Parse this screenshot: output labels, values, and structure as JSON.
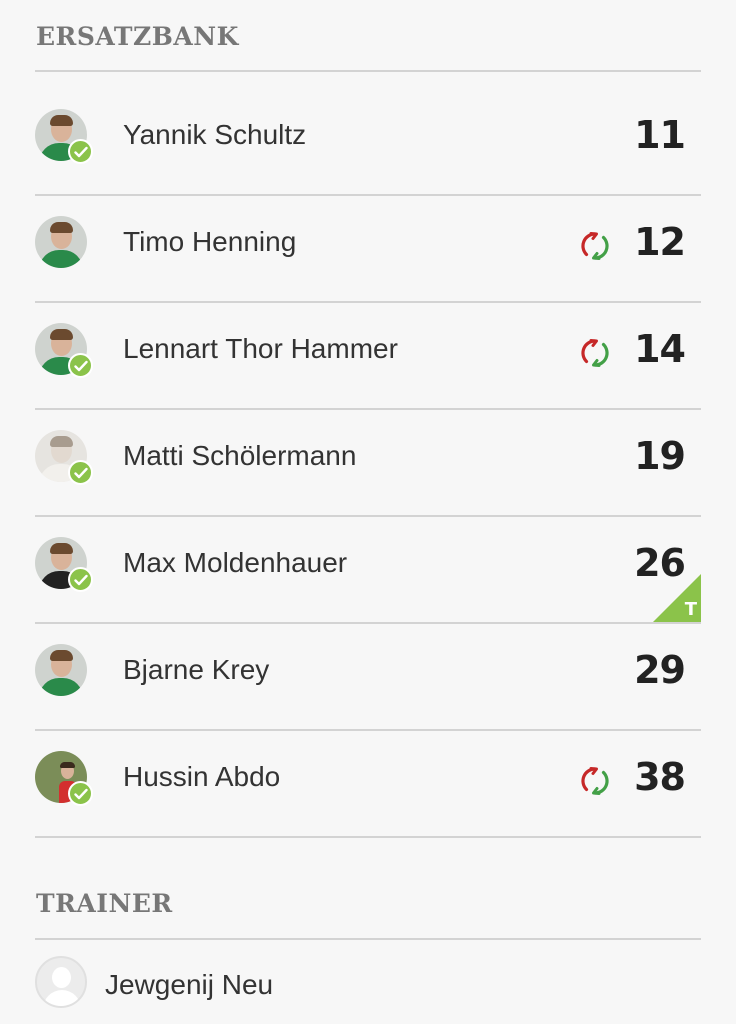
{
  "bench": {
    "title": "ERSATZBANK",
    "players": [
      {
        "name": "Yannik Schultz",
        "number": "11",
        "confirmed": true,
        "substituted": false,
        "avatar": "player-photo-green-jersey"
      },
      {
        "name": "Timo Henning",
        "number": "12",
        "confirmed": false,
        "substituted": true,
        "avatar": "player-photo-green-jersey"
      },
      {
        "name": "Lennart Thor Hammer",
        "number": "14",
        "confirmed": true,
        "substituted": true,
        "avatar": "player-photo-green-jersey"
      },
      {
        "name": "Matti Schölermann",
        "number": "19",
        "confirmed": true,
        "substituted": false,
        "avatar": "player-photo-black-white"
      },
      {
        "name": "Max Moldenhauer",
        "number": "26",
        "confirmed": true,
        "substituted": false,
        "avatar": "player-photo-dark-jersey",
        "badge": "T"
      },
      {
        "name": "Bjarne Krey",
        "number": "29",
        "confirmed": false,
        "substituted": false,
        "avatar": "player-photo-green-jersey"
      },
      {
        "name": "Hussin Abdo",
        "number": "38",
        "confirmed": true,
        "substituted": true,
        "avatar": "player-photo-field-red-jersey"
      }
    ]
  },
  "trainer": {
    "title": "TRAINER",
    "name": "Jewgenij Neu",
    "avatar": "placeholder-user-icon"
  },
  "colors": {
    "confirmed_green": "#8bc34a",
    "swap_red": "#c62828",
    "swap_green": "#43a047",
    "title_gray": "#777777",
    "divider_gray": "#d3d3d3"
  }
}
